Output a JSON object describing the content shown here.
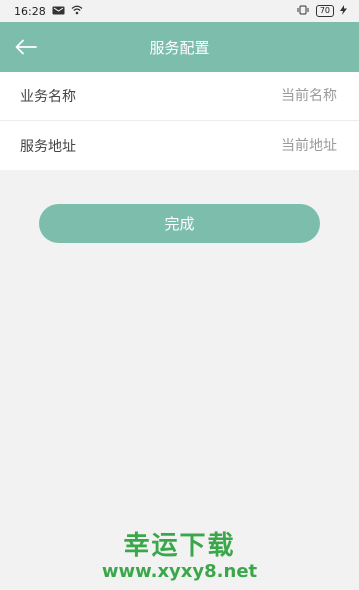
{
  "status_bar": {
    "time": "16:28",
    "battery": "70"
  },
  "header": {
    "title": "服务配置",
    "back_icon": "arrow-left-icon"
  },
  "form": {
    "rows": [
      {
        "label": "业务名称",
        "placeholder": "当前名称",
        "value": ""
      },
      {
        "label": "服务地址",
        "placeholder": "当前地址",
        "value": ""
      }
    ]
  },
  "actions": {
    "done_label": "完成"
  },
  "watermark": {
    "line1": "幸运下载",
    "line2": "www.xyxy8.net"
  },
  "colors": {
    "accent": "#7dbdac",
    "background": "#f2f2f2",
    "watermark": "#3aa84a"
  }
}
